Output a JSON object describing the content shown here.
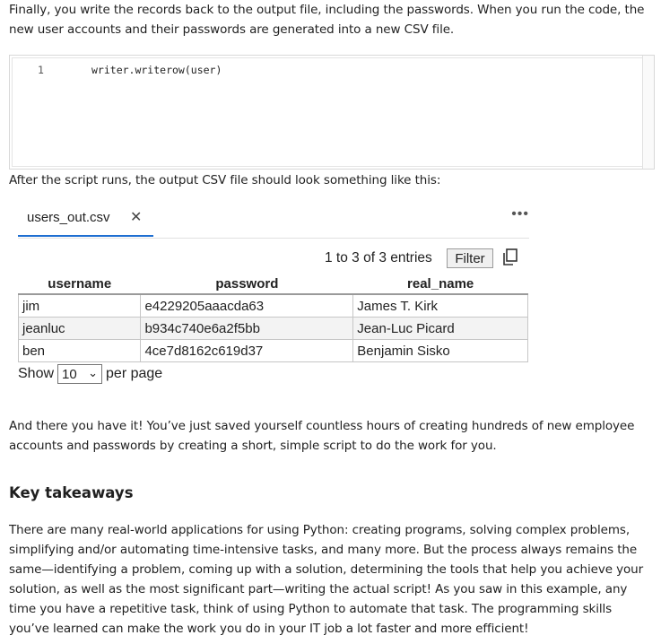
{
  "intro_paragraph": "Finally, you write the records back to the output file, including the passwords. When you run the code, the new user accounts and their passwords are generated into a new CSV file.",
  "code": {
    "line_number": "1",
    "line_text": "writer.writerow(user)"
  },
  "after_script_text": "After the script runs, the output CSV file should look something like this:",
  "csv_viewer": {
    "tab_label": "users_out.csv",
    "close_glyph": "✕",
    "more_glyph": "•••",
    "entries_info": "1 to 3 of 3 entries",
    "filter_label": "Filter",
    "copy_icon": "copy-icon",
    "columns": [
      "username",
      "password",
      "real_name"
    ],
    "rows": [
      [
        "jim",
        "e4229205aaacda63",
        "James T. Kirk"
      ],
      [
        "jeanluc",
        "b934c740e6a2f5bb",
        "Jean-Luc Picard"
      ],
      [
        "ben",
        "4ce7d8162c619d37",
        "Benjamin Sisko"
      ]
    ],
    "show_label": "Show",
    "page_size": "10",
    "per_page_label": "per page"
  },
  "conclusion_paragraph": "And there you have it! You’ve just saved yourself countless hours of creating hundreds of new employee accounts and passwords by creating a short, simple script to do the work for you.",
  "key_takeaways_heading": "Key takeaways",
  "key_takeaways_paragraph": "There are many real-world applications for using Python: creating programs, solving complex problems, simplifying and/or automating time-intensive tasks, and many more. But the process always remains the same—identifying a problem, coming up with a solution, determining the tools that help you achieve your solution, as well as the most significant part—writing the actual script! As you saw in this example, any time you have a repetitive task, think of using Python to automate that task. The programming skills you’ve learned can make the work you do in your IT job a lot faster and more efficient!"
}
